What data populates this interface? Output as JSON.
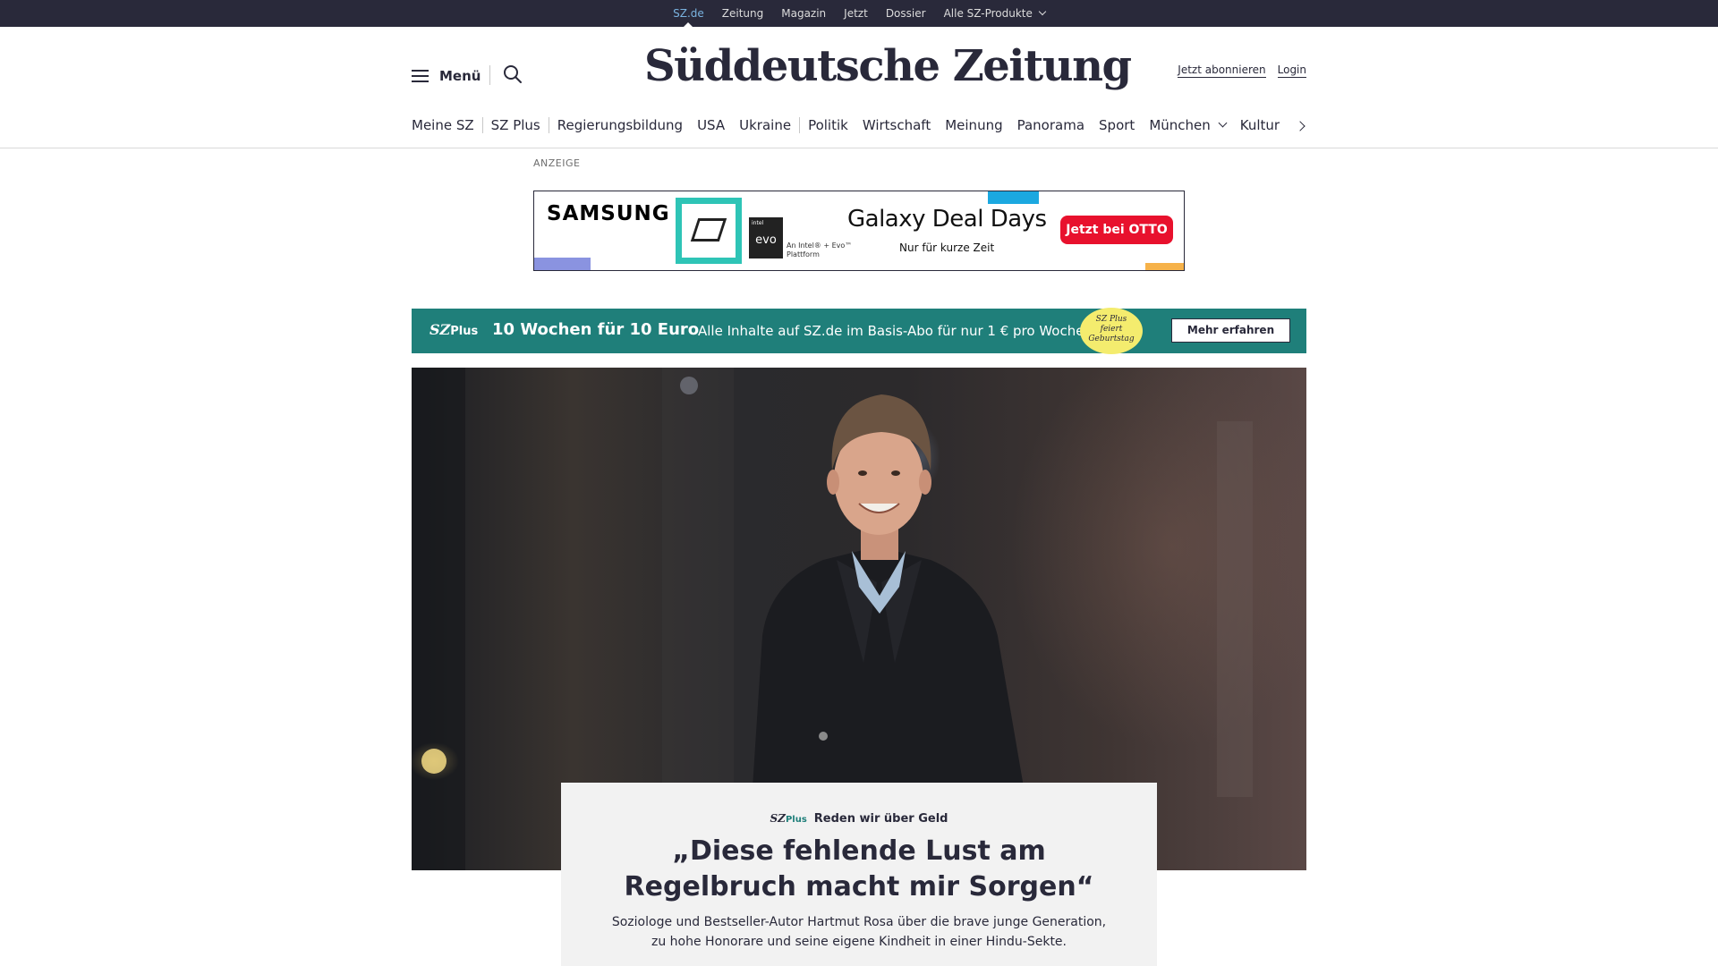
{
  "topbar": {
    "links": [
      "SZ.de",
      "Zeitung",
      "Magazin",
      "Jetzt",
      "Dossier",
      "Alle SZ-Produkte"
    ]
  },
  "header": {
    "menu_label": "Menü",
    "logo": "Süddeutsche Zeitung",
    "subscribe": "Jetzt abonnieren",
    "login": "Login"
  },
  "nav": {
    "items": [
      "Meine SZ",
      "SZ Plus",
      "Regierungsbildung",
      "USA",
      "Ukraine",
      "Politik",
      "Wirtschaft",
      "Meinung",
      "Panorama",
      "Sport",
      "München",
      "Kultur"
    ]
  },
  "ad": {
    "label": "ANZEIGE",
    "brand": "SAMSUNG",
    "evo_top": "intel",
    "evo": "evo",
    "evo_text": "An Intel® + Evo™ Plattform",
    "headline": "Galaxy Deal Days",
    "subline": "Nur für kurze Zeit",
    "cta": "Jetzt bei OTTO",
    "colors": {
      "samsung_tile": "#2ec4b6",
      "cta": "#e8112d",
      "accent_blue": "#1ba8e0"
    }
  },
  "promo": {
    "logo_sz": "SZ",
    "logo_plus": "Plus",
    "title": "10 Wochen für 10 Euro",
    "text": "Alle Inhalte auf SZ.de im Basis-Abo für nur 1 € pro Woche.",
    "badge_line1": "SZ Plus",
    "badge_line2": "feiert",
    "badge_line3": "Geburtstag",
    "button": "Mehr erfahren",
    "color": "#1f7f7a"
  },
  "article": {
    "kicker_sz": "SZ",
    "kicker_plus": "Plus",
    "kicker": "Reden wir über Geld",
    "headline": "„Diese fehlende Lust am Regelbruch macht mir Sorgen“",
    "teaser": "Soziologe und Bestseller-Autor Hartmut Rosa über die brave junge Generation, zu hohe Honorare und seine eigene Kindheit in einer Hindu-Sekte."
  }
}
